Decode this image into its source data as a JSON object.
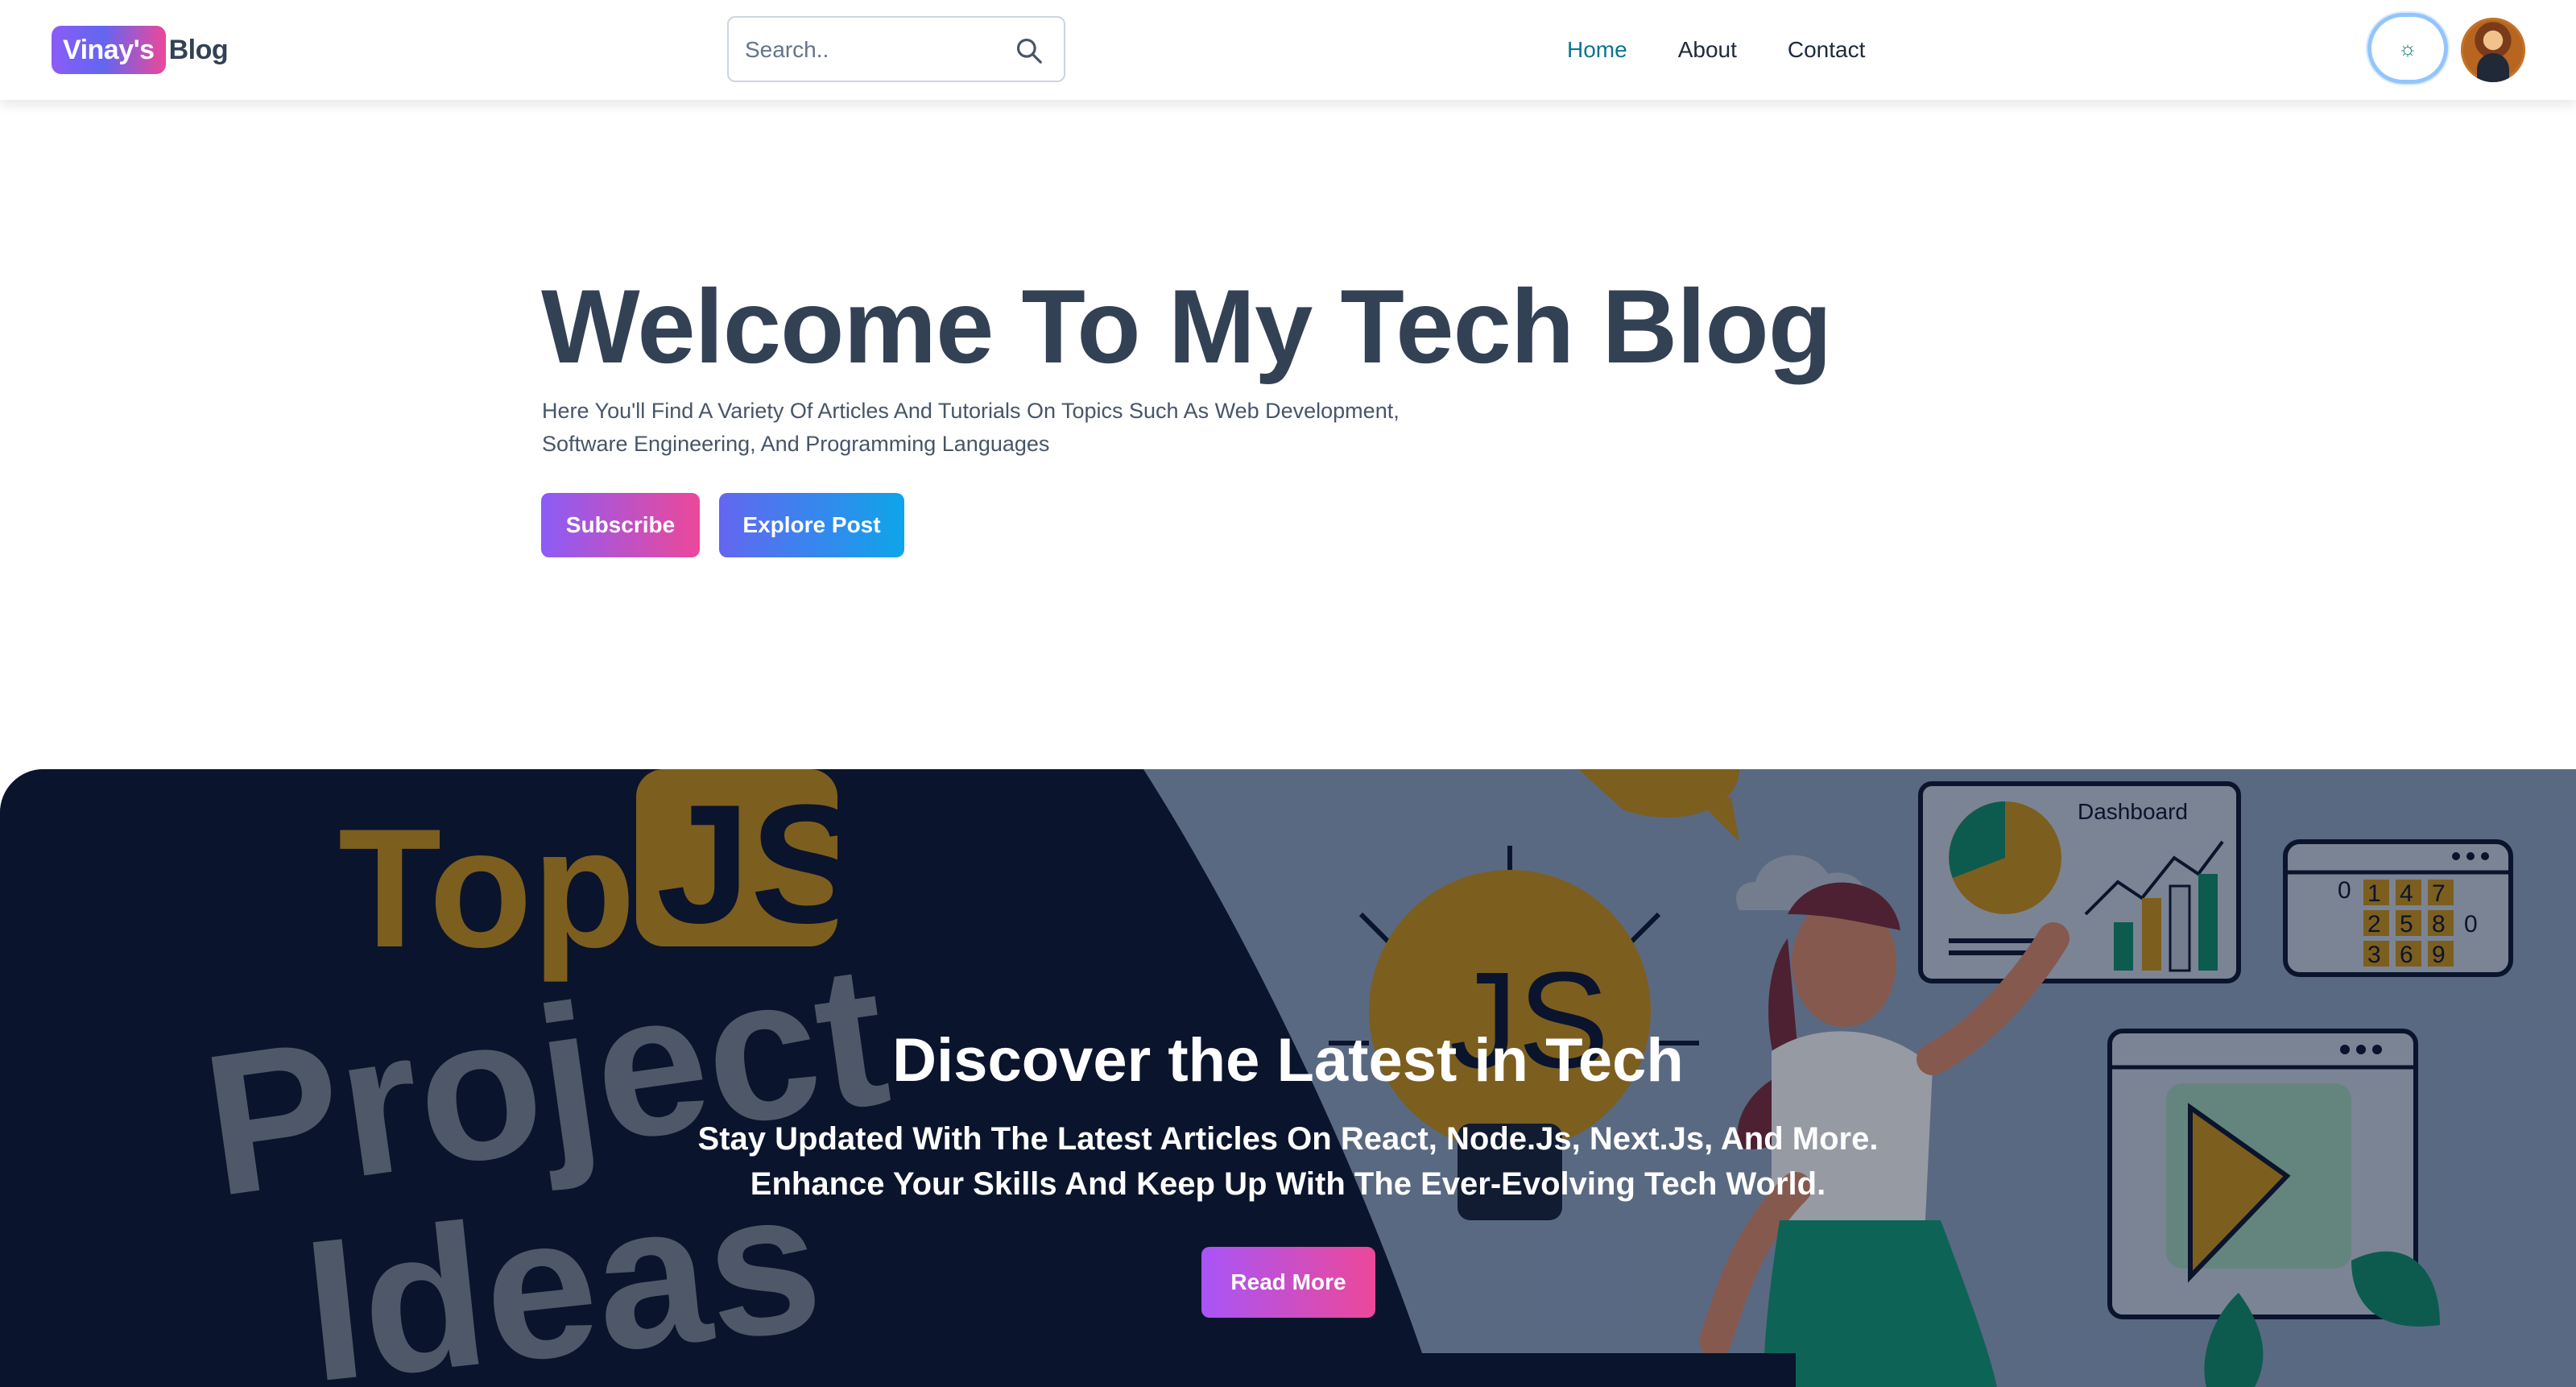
{
  "navbar": {
    "brand_highlight": "Vinay's",
    "brand_rest": "Blog",
    "search_placeholder": "Search..",
    "links": [
      {
        "label": "Home",
        "active": true
      },
      {
        "label": "About",
        "active": false
      },
      {
        "label": "Contact",
        "active": false
      }
    ],
    "theme_toggle_glyph": "☼",
    "accent_color": "#0e7490"
  },
  "hero": {
    "title": "Welcome To My Tech Blog",
    "description_line1": "Here You'll Find A Variety Of Articles And Tutorials On Topics Such As Web Development,",
    "description_line2": "Software Engineering, And Programming Languages",
    "subscribe_label": "Subscribe",
    "explore_label": "Explore Post"
  },
  "banner": {
    "title": "Discover the Latest in Tech",
    "subtitle_line1": "Stay Updated With The Latest Articles On React, Node.Js, Next.Js, And More.",
    "subtitle_line2": "Enhance Your Skills And Keep Up With The Ever-Evolving Tech World.",
    "read_more_label": "Read More",
    "art": {
      "word_top": "Top",
      "word_js": "JS",
      "word_project": "Project",
      "word_ideas": "Ideas",
      "bulb_text": "JS",
      "dashboard_label": "Dashboard",
      "calculator_digits": [
        "0",
        "1",
        "4",
        "7",
        "2",
        "5",
        "8",
        "0",
        "3",
        "6",
        "9"
      ]
    }
  }
}
